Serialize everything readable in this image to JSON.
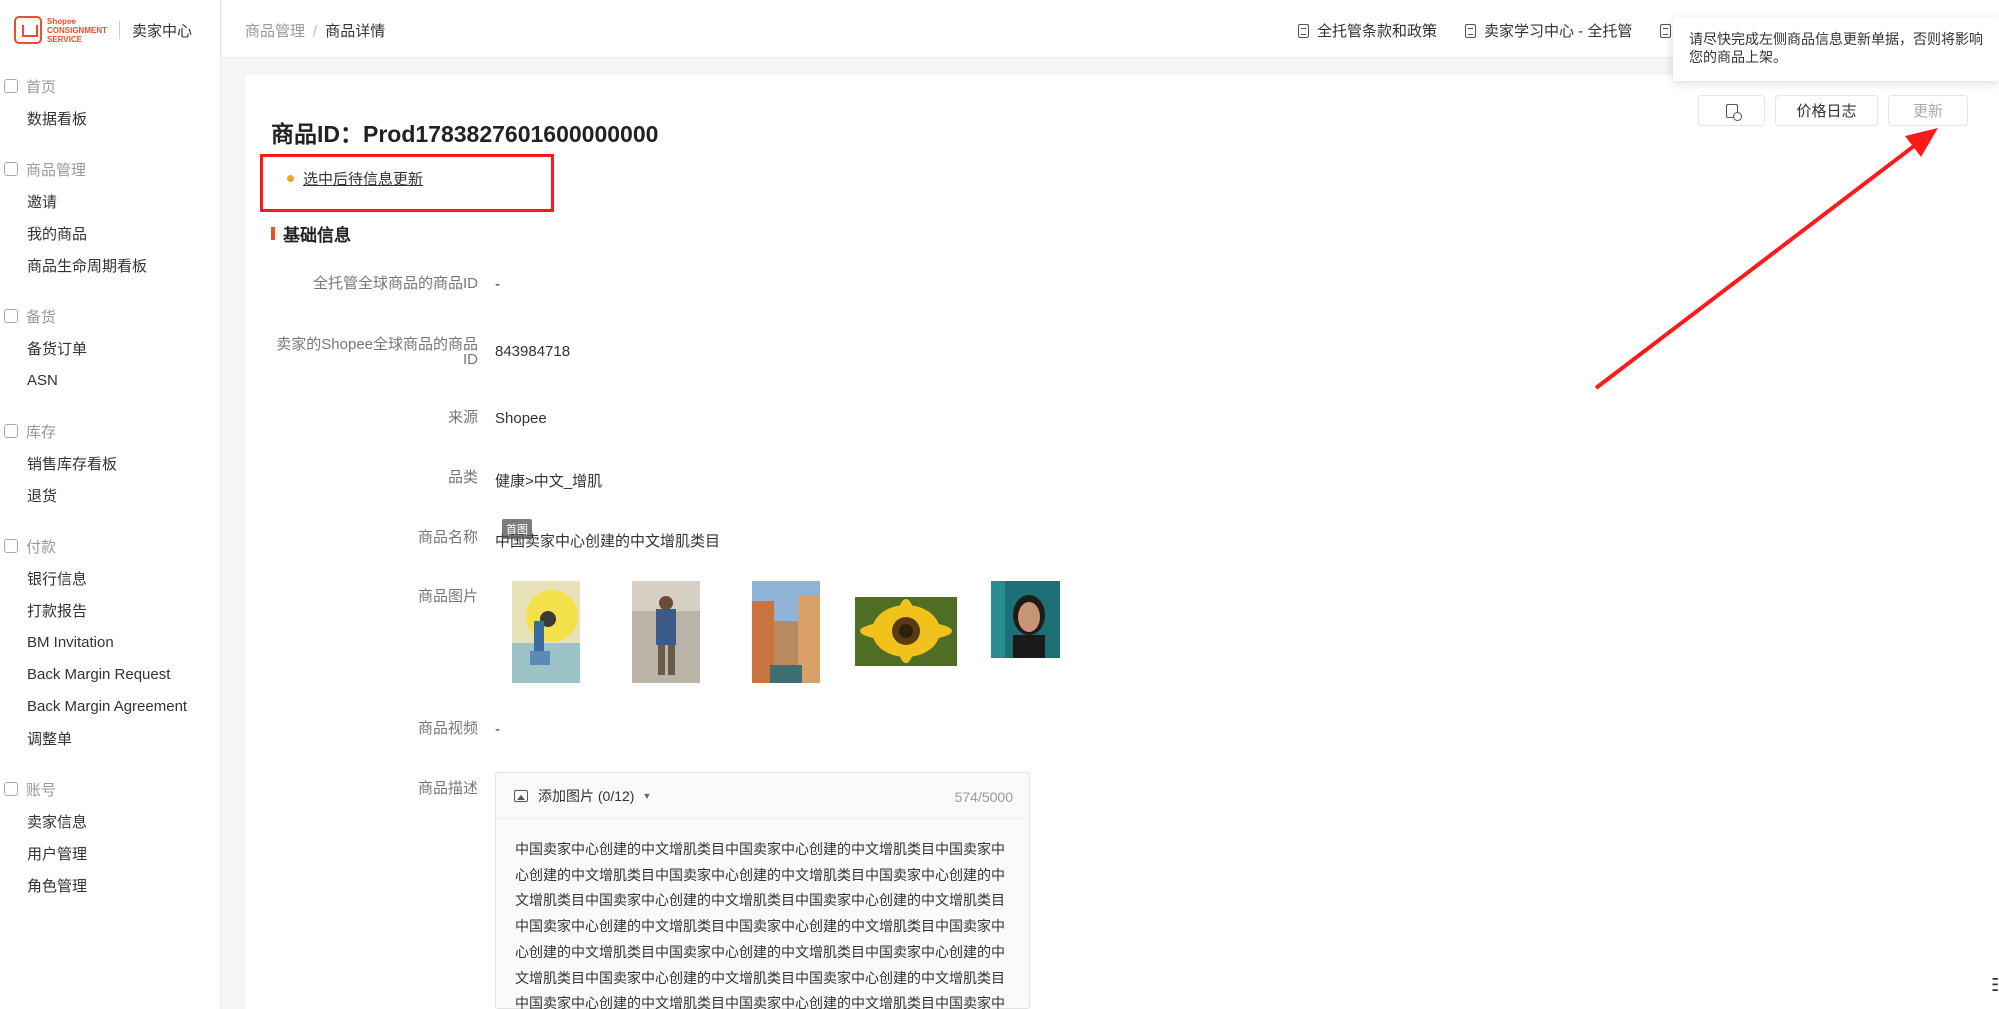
{
  "sidebar": {
    "logo": {
      "brand": "Shopee",
      "line1": "CONSIGNMENT",
      "line2": "SERVICE",
      "title": "卖家中心"
    },
    "groups": [
      {
        "title": "首页",
        "icon": "home-icon",
        "items": [
          "数据看板"
        ]
      },
      {
        "title": "商品管理",
        "icon": "box-icon",
        "items": [
          "邀请",
          "我的商品",
          "商品生命周期看板"
        ]
      },
      {
        "title": "备货",
        "icon": "clipboard-icon",
        "items": [
          "备货订单",
          "ASN"
        ]
      },
      {
        "title": "库存",
        "icon": "warehouse-icon",
        "items": [
          "销售库存看板",
          "退货"
        ]
      },
      {
        "title": "付款",
        "icon": "wallet-icon",
        "items": [
          "银行信息",
          "打款报告",
          "BM Invitation",
          "Back Margin Request",
          "Back Margin Agreement",
          "调整单"
        ]
      },
      {
        "title": "账号",
        "icon": "user-icon",
        "items": [
          "卖家信息",
          "用户管理",
          "角色管理"
        ]
      }
    ]
  },
  "header": {
    "breadcrumb": {
      "parent": "商品管理",
      "separator": "/",
      "current": "商品详情"
    },
    "links": [
      "全托管条款和政策",
      "卖家学习中心 - 全托管"
    ]
  },
  "product": {
    "title": "商品ID：Prod1783827601600000000",
    "pending_label": "选中后待信息更新",
    "section": "基础信息",
    "toolbar": {
      "price_log": "价格日志",
      "update": "更新"
    },
    "fields": {
      "global_id": {
        "label": "全托管全球商品的商品ID",
        "value": "-"
      },
      "shopee_id": {
        "label_line1": "卖家的Shopee全球商品的商品",
        "label_line2": "ID",
        "value": "843984718"
      },
      "source": {
        "label": "来源",
        "value": "Shopee"
      },
      "category": {
        "label": "品类",
        "value": "健康>中文_增肌"
      },
      "name": {
        "label": "商品名称",
        "value": "中国卖家中心创建的中文增肌类目"
      },
      "images": {
        "label": "商品图片",
        "cover_tag": "首图"
      },
      "video": {
        "label": "商品视频",
        "value": "-"
      },
      "description": {
        "label": "商品描述",
        "add_image": "添加图片 (0/12)",
        "counter": "574/5000",
        "text": "中国卖家中心创建的中文增肌类目中国卖家中心创建的中文增肌类目中国卖家中心创建的中文增肌类目中国卖家中心创建的中文增肌类目中国卖家中心创建的中文增肌类目中国卖家中心创建的中文增肌类目中国卖家中心创建的中文增肌类目中国卖家中心创建的中文增肌类目中国卖家中心创建的中文增肌类目中国卖家中心创建的中文增肌类目中国卖家中心创建的中文增肌类目中国卖家中心创建的中文增肌类目中国卖家中心创建的中文增肌类目中国卖家中心创建的中文增肌类目中国卖家中心创建的中文增肌类目中国卖家中心创建的中文增肌类目中国卖家中心创建的中文增肌类目中国卖家中心"
      }
    }
  },
  "tooltip": {
    "text": "请尽快完成左侧商品信息更新单据，否则将影响您的商品上架。"
  },
  "colors": {
    "accent": "#ee4d2d",
    "highlight_box": "#ff1a1a",
    "pending_dot": "#f5a623"
  }
}
